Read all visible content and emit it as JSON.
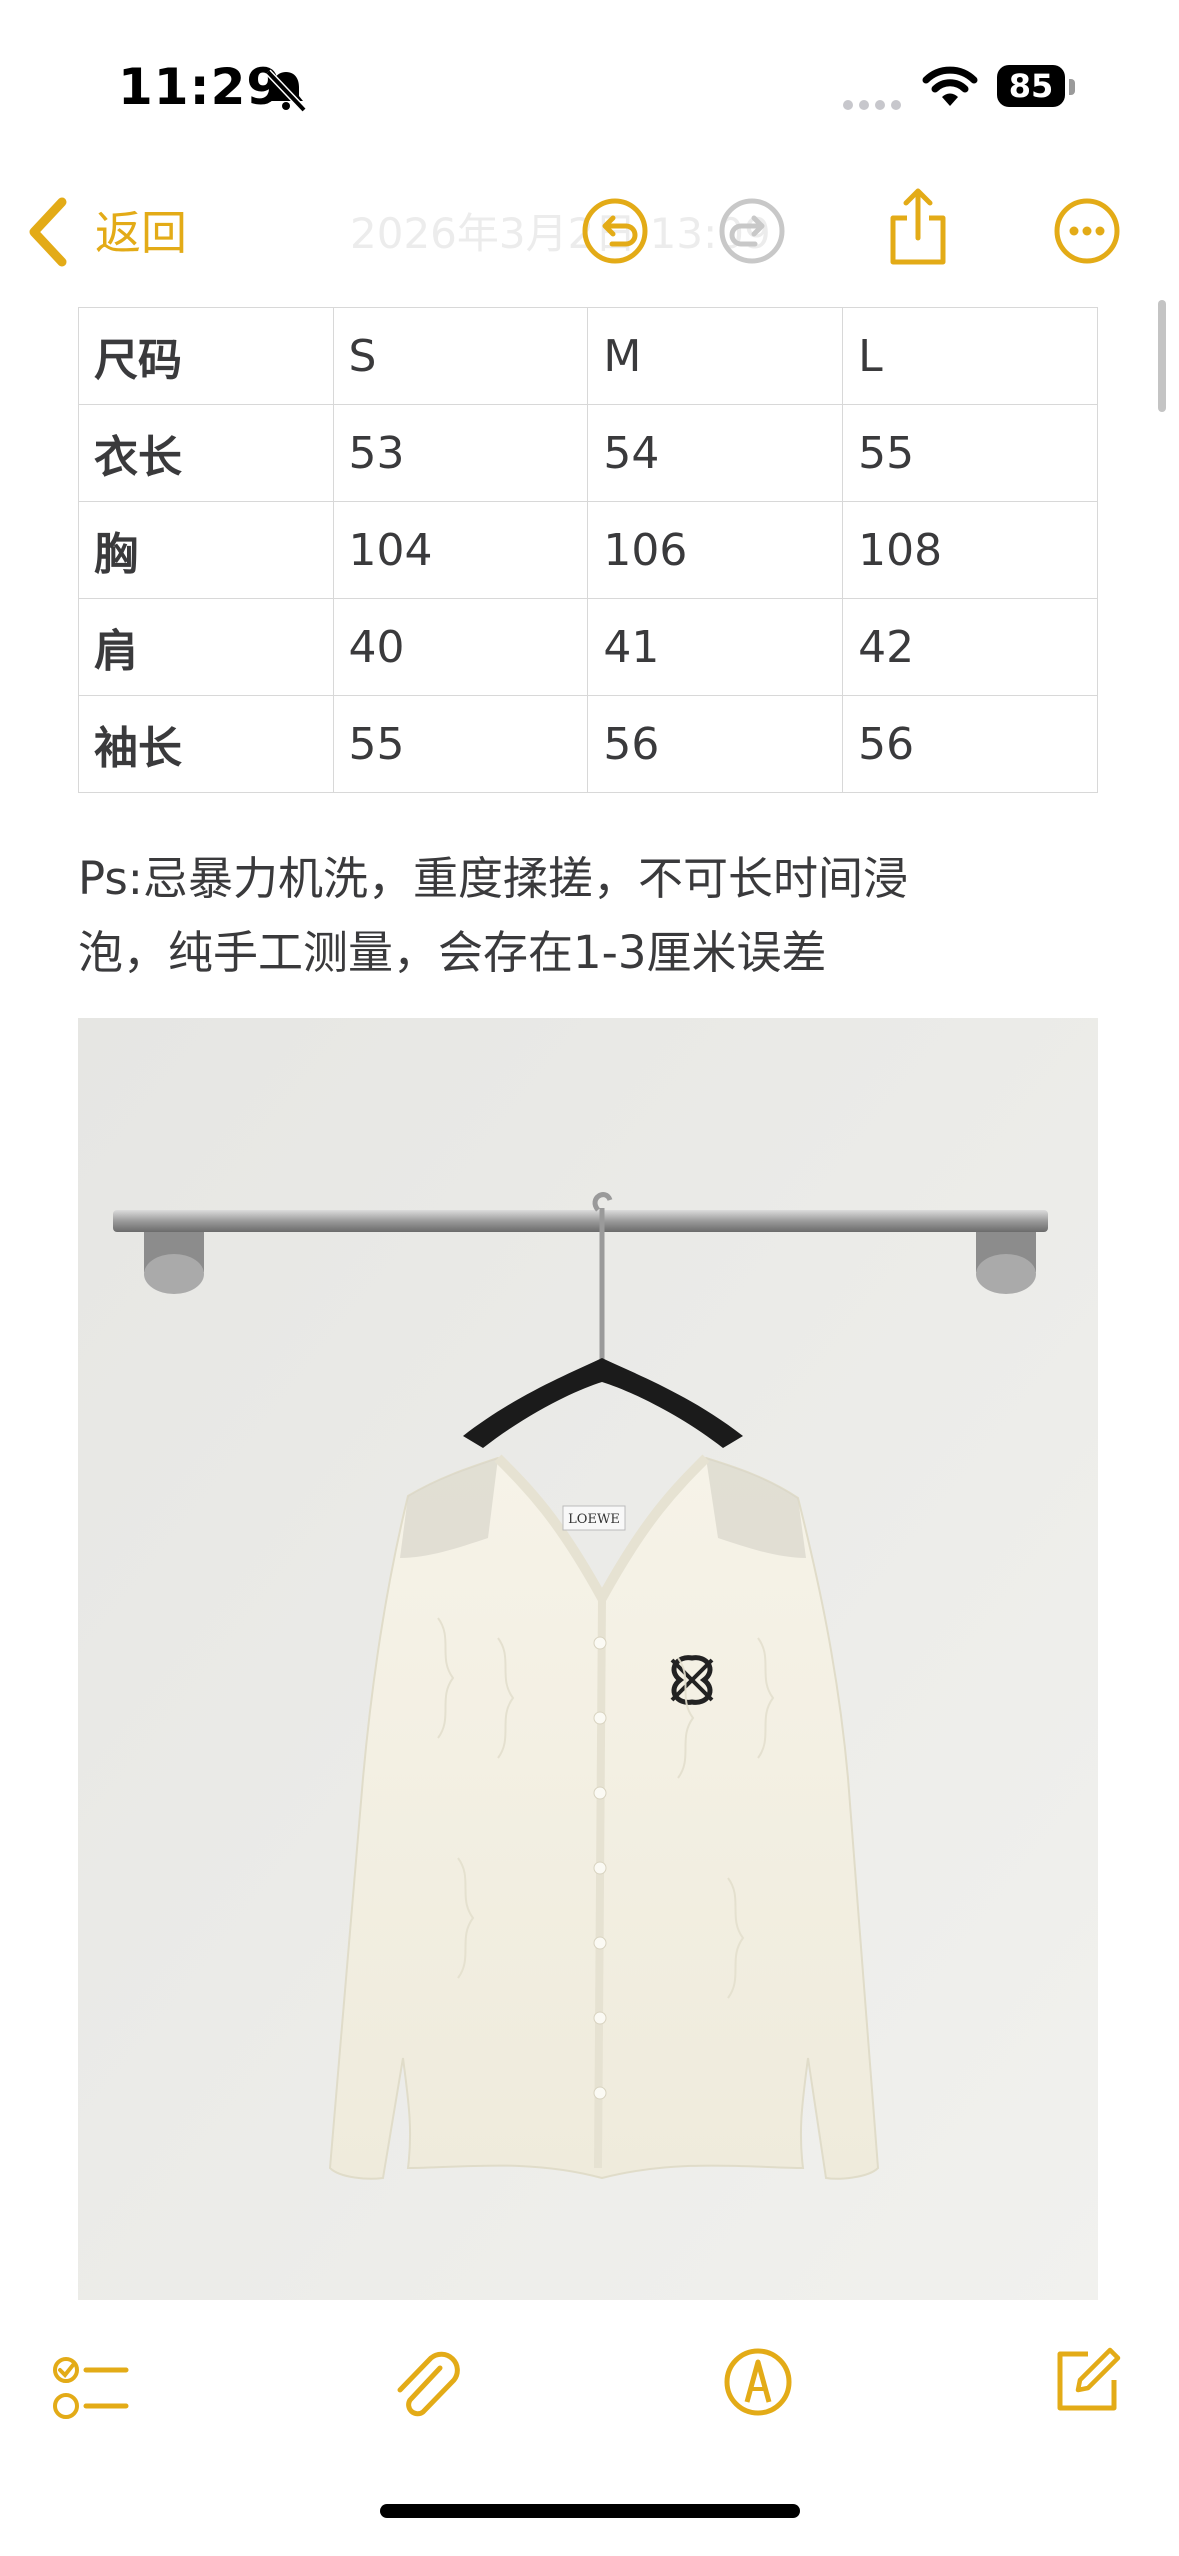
{
  "status_bar": {
    "time": "11:29",
    "battery_level": "85",
    "icons": [
      "bell-slash-icon",
      "signal-dots-icon",
      "wifi-icon",
      "battery-icon"
    ]
  },
  "nav": {
    "back_label": "返回",
    "faded_title": "2026年3月2日 13:09",
    "icons": [
      "chevron-left-icon",
      "undo-icon",
      "redo-icon",
      "share-icon",
      "more-icon"
    ],
    "accent_color": "#e3ab17"
  },
  "size_table": {
    "header": [
      "尺码",
      "S",
      "M",
      "L"
    ],
    "rows": [
      [
        "衣长",
        "53",
        "54",
        "55"
      ],
      [
        "胸",
        "104",
        "106",
        "108"
      ],
      [
        "肩",
        "40",
        "41",
        "42"
      ],
      [
        "袖长",
        "55",
        "56",
        "56"
      ]
    ]
  },
  "note": {
    "line1": "Ps:忌暴力机洗，重度揉搓，不可长时间浸",
    "line2": "泡，纯手工测量，会存在1-3厘米误差"
  },
  "photo": {
    "label_text": "LOEWE",
    "description_icon": "cardigan-photo"
  },
  "toolbar": {
    "icons": [
      "checklist-icon",
      "paperclip-icon",
      "markup-pen-icon",
      "compose-icon"
    ]
  }
}
